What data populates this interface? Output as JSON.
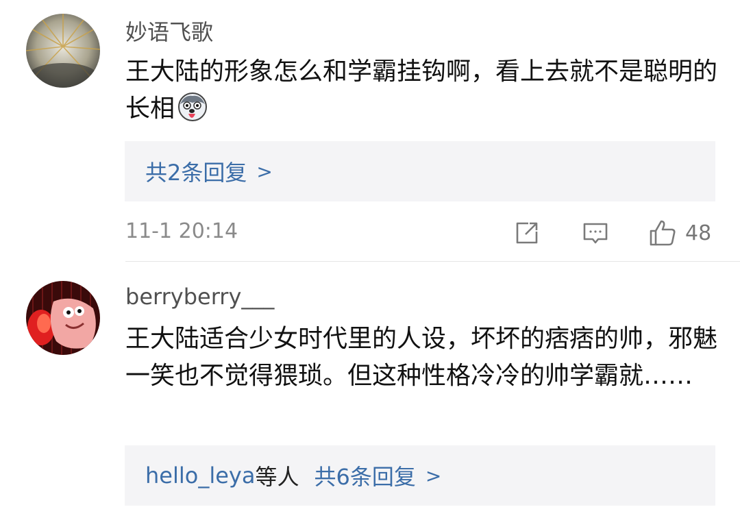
{
  "comments": [
    {
      "username": "妙语飞歌",
      "text": "王大陆的形象怎么和学霸挂钩啊，看上去就不是聪明的长相",
      "emoji_icon": "husky-tongue-emoji-icon",
      "replies": {
        "users": "",
        "suffix": "",
        "summary": "共2条回复",
        "chevron": ">"
      },
      "timestamp": "11-1 20:14",
      "like_count": "48"
    },
    {
      "username": "berryberry___",
      "text": "王大陆适合少女时代里的人设，坏坏的痞痞的帅，邪魅一笑也不觉得猥琐。但这种性格冷冷的帅学霸就……",
      "replies": {
        "users": "hello_leya",
        "suffix": "等人",
        "summary": "共6条回复",
        "chevron": ">"
      }
    }
  ],
  "colors": {
    "link": "#3b6da8",
    "reply_bg": "#f4f4f6",
    "meta_gray": "#8a8a8a"
  }
}
